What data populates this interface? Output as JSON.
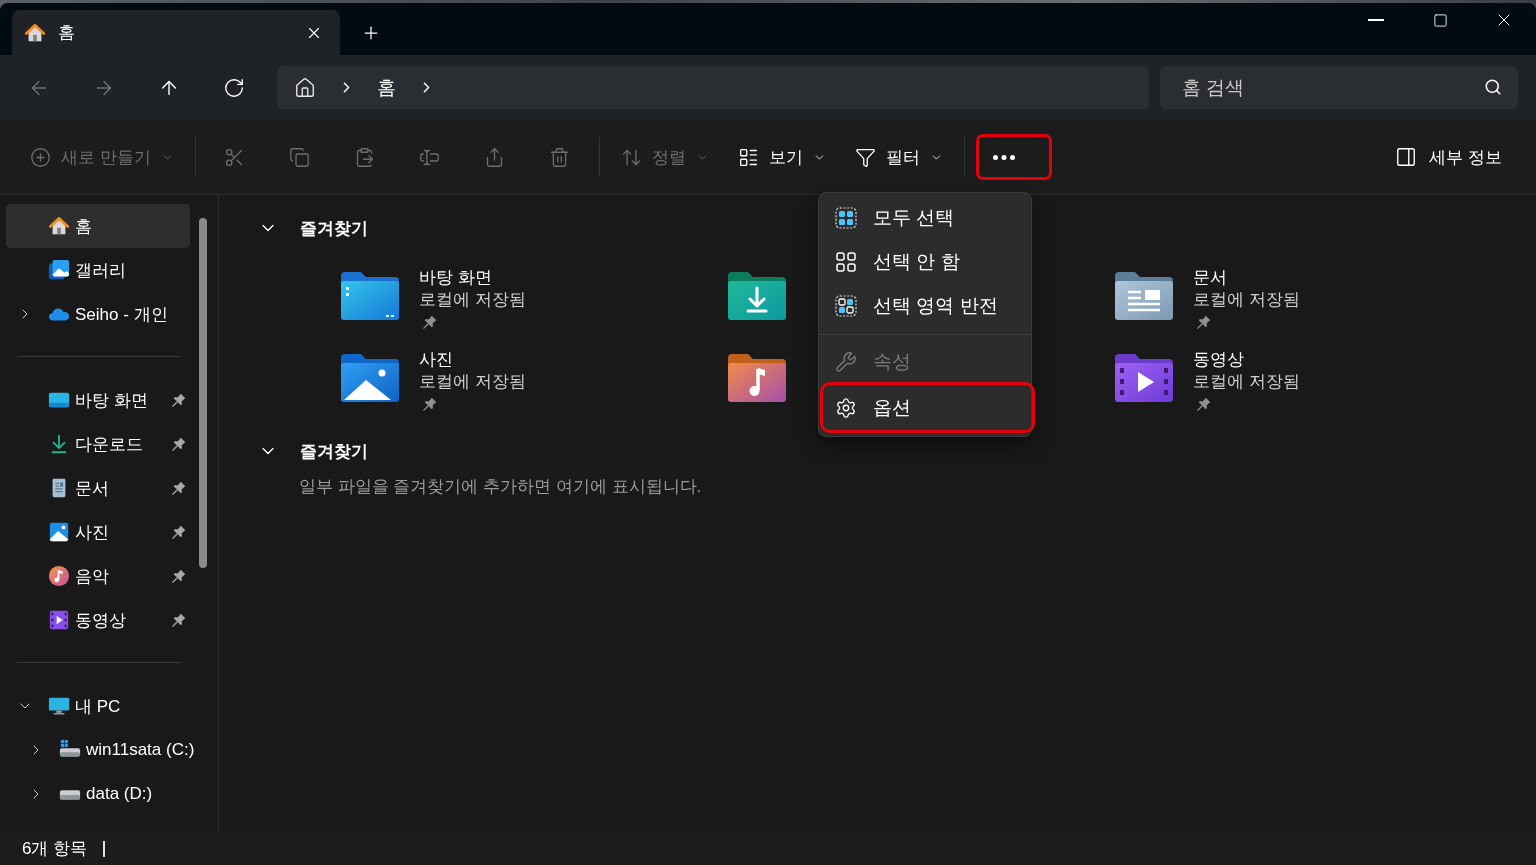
{
  "tabs": [
    {
      "title": "홈",
      "kind": "home",
      "selected": true
    }
  ],
  "navigation": [
    {
      "kind": "back",
      "disabled": true
    },
    {
      "kind": "forward",
      "disabled": true
    },
    {
      "kind": "up",
      "disabled": false
    },
    {
      "kind": "refresh",
      "disabled": false
    }
  ],
  "address_bar": {
    "crumbs": [
      "홈"
    ]
  },
  "search": {
    "placeholder": "홈 검색"
  },
  "toolbar": {
    "items": [
      {
        "kind": "new",
        "label": "새로 만들기",
        "dropdown": true,
        "disabled": true,
        "highlighted": false
      },
      {
        "kind": "divider"
      },
      {
        "kind": "cut",
        "disabled": true,
        "highlighted": false
      },
      {
        "kind": "copy",
        "disabled": true,
        "highlighted": false
      },
      {
        "kind": "paste",
        "disabled": true,
        "highlighted": false
      },
      {
        "kind": "rename",
        "disabled": true,
        "highlighted": false
      },
      {
        "kind": "share",
        "disabled": true,
        "highlighted": false
      },
      {
        "kind": "delete",
        "disabled": true,
        "highlighted": false
      },
      {
        "kind": "divider"
      },
      {
        "kind": "sort",
        "label": "정렬",
        "dropdown": true,
        "disabled": true,
        "highlighted": false
      },
      {
        "kind": "view",
        "label": "보기",
        "dropdown": true,
        "disabled": false,
        "highlighted": false
      },
      {
        "kind": "filter",
        "label": "필터",
        "dropdown": true,
        "disabled": false,
        "highlighted": false
      },
      {
        "kind": "divider"
      },
      {
        "kind": "more",
        "disabled": false,
        "highlighted": true
      }
    ],
    "details": {
      "label": "세부 정보"
    }
  },
  "sidebar": {
    "groups": [
      {
        "items": [
          {
            "label": "홈",
            "kind": "home",
            "selected": true,
            "pinned": false
          },
          {
            "label": "갤러리",
            "kind": "gallery",
            "selected": false,
            "pinned": false
          },
          {
            "label": "Seiho - 개인",
            "kind": "onedrive",
            "selected": false,
            "pinned": false,
            "expanded": false
          }
        ]
      },
      {
        "items": [
          {
            "label": "바탕 화면",
            "kind": "desktop",
            "selected": false,
            "pinned": true
          },
          {
            "label": "다운로드",
            "kind": "downloads",
            "selected": false,
            "pinned": true
          },
          {
            "label": "문서",
            "kind": "documents",
            "selected": false,
            "pinned": true
          },
          {
            "label": "사진",
            "kind": "pictures",
            "selected": false,
            "pinned": true
          },
          {
            "label": "음악",
            "kind": "music",
            "selected": false,
            "pinned": true
          },
          {
            "label": "동영상",
            "kind": "videos",
            "selected": false,
            "pinned": true
          }
        ]
      },
      {
        "items": [
          {
            "label": "내 PC",
            "kind": "pc",
            "selected": false,
            "pinned": false,
            "expanded": true,
            "children": [
              {
                "label": "win11sata (C:)",
                "kind": "system-drive",
                "selected": false,
                "pinned": false,
                "expanded": false
              },
              {
                "label": "data (D:)",
                "kind": "drive",
                "selected": false,
                "pinned": false,
                "expanded": false
              }
            ]
          }
        ]
      }
    ]
  },
  "content": {
    "sections": [
      {
        "title": "즐겨찾기",
        "expanded": true,
        "items": [
          {
            "kind": "desktop",
            "name": "바탕 화면",
            "location": "로컬에 저장됨",
            "pinned": true
          },
          {
            "kind": "downloads"
          },
          {
            "kind": "documents",
            "name": "문서",
            "location": "로컬에 저장됨",
            "pinned": true
          },
          {
            "kind": "pictures",
            "name": "사진",
            "location": "로컬에 저장됨",
            "pinned": true
          },
          {
            "kind": "music"
          },
          {
            "kind": "videos",
            "name": "동영상",
            "location": "로컬에 저장됨",
            "pinned": true
          }
        ]
      },
      {
        "title": "즐겨찾기",
        "expanded": true,
        "empty_message": "일부 파일을 즐겨찾기에 추가하면 여기에 표시됩니다."
      }
    ]
  },
  "context_menu": {
    "items": [
      {
        "kind": "select-all",
        "label": "모두 선택",
        "disabled": false,
        "highlighted": false
      },
      {
        "kind": "select-none",
        "label": "선택 안 함",
        "disabled": false,
        "highlighted": false
      },
      {
        "kind": "invert-selection",
        "label": "선택 영역 반전",
        "disabled": false,
        "highlighted": false
      },
      {
        "kind": "divider"
      },
      {
        "kind": "properties",
        "label": "속성",
        "disabled": true,
        "highlighted": false
      },
      {
        "kind": "options",
        "label": "옵션",
        "disabled": false,
        "highlighted": true
      }
    ]
  },
  "status_bar": {
    "item_count": "6개 항목"
  }
}
